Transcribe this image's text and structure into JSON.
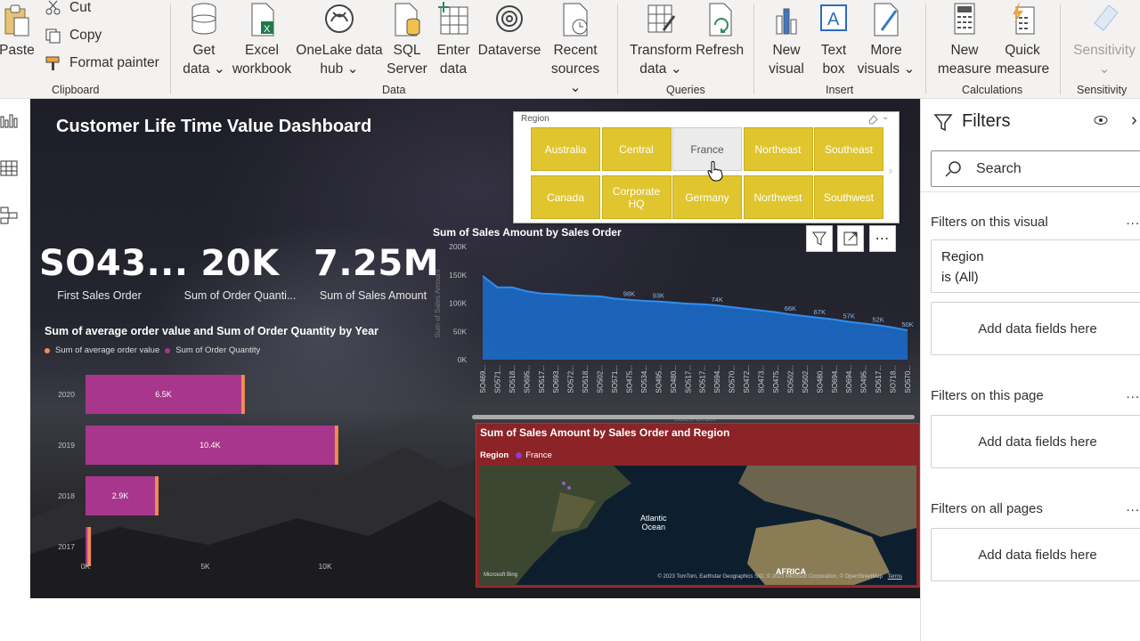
{
  "ribbon": {
    "clipboard": {
      "paste": "Paste",
      "cut": "Cut",
      "copy": "Copy",
      "format_painter": "Format painter",
      "group": "Clipboard"
    },
    "data": {
      "get_data": "Get\ndata ⌄",
      "excel": "Excel\nworkbook",
      "onelake": "OneLake data\nhub ⌄",
      "sql": "SQL\nServer",
      "enter": "Enter\ndata",
      "dataverse": "Dataverse",
      "recent": "Recent\nsources ⌄",
      "group": "Data"
    },
    "queries": {
      "transform": "Transform\ndata ⌄",
      "refresh": "Refresh",
      "group": "Queries"
    },
    "insert": {
      "new_visual": "New\nvisual",
      "text_box": "Text\nbox",
      "more_visuals": "More\nvisuals ⌄",
      "group": "Insert"
    },
    "calculations": {
      "new_measure": "New\nmeasure",
      "quick_measure": "Quick\nmeasure",
      "group": "Calculations"
    },
    "sensitivity": {
      "label": "Sensitivity\n⌄",
      "group": "Sensitivity"
    }
  },
  "dashboard": {
    "title": "Customer Life Time Value Dashboard",
    "kpis": [
      {
        "value": "SO43...",
        "label": "First Sales Order"
      },
      {
        "value": "20K",
        "label": "Sum of Order Quanti..."
      },
      {
        "value": "7.25M",
        "label": "Sum of Sales Amount"
      }
    ]
  },
  "slicer": {
    "title": "Region",
    "items": [
      "Australia",
      "Central",
      "France",
      "Northeast",
      "Southeast",
      "Canada",
      "Corporate\nHQ",
      "Germany",
      "Northwest",
      "Southwest"
    ],
    "selected": "France"
  },
  "bar_chart": {
    "title": "Sum of average order value and Sum of Order Quantity by Year",
    "legend": [
      "Sum of average order value",
      "Sum of Order Quantity"
    ]
  },
  "area_chart": {
    "title": "Sum of Sales Amount by Sales Order",
    "ylabel": "Sum of Sales Amount",
    "xlabel": "Sales Order",
    "x_ticks": [
      "SO469...",
      "SO571...",
      "SO518...",
      "SO695...",
      "SO517...",
      "SO693...",
      "SO572...",
      "SO518...",
      "SO502...",
      "SO571...",
      "SO475...",
      "SO534...",
      "SO495...",
      "SO480...",
      "SO517...",
      "SO517...",
      "SO694...",
      "SO570...",
      "SO472...",
      "SO473...",
      "SO475...",
      "SO502...",
      "SO502...",
      "SO480...",
      "SO694...",
      "SO694...",
      "SO495...",
      "SO517...",
      "SO718...",
      "SO570..."
    ],
    "point_labels": [
      "98K",
      "93K",
      "74K",
      "66K",
      "67K",
      "57K",
      "52K",
      "50K"
    ]
  },
  "map": {
    "title": "Sum of Sales Amount by Sales Order and Region",
    "legend_title": "Region",
    "legend_item": "France",
    "ocean_label": "Atlantic\nOcean",
    "africa_label": "AFRICA",
    "bing": "Microsoft Bing",
    "attribution": "© 2023 TomTom, Earthstar Geographics SIO, © 2023 Microsoft Corporation, © OpenStreetMap",
    "terms": "Terms"
  },
  "filters": {
    "title": "Filters",
    "search_placeholder": "Search",
    "on_visual": "Filters on this visual",
    "region_field": "Region",
    "region_value": "is (All)",
    "add_fields": "Add data fields here",
    "on_page": "Filters on this page",
    "on_all": "Filters on all pages",
    "dots": "..."
  },
  "colors": {
    "accent_purple": "#a7368c",
    "accent_orange": "#f28a57",
    "area_blue": "#1a6fd1",
    "slicer_yellow": "#e0c52e",
    "map_header": "#8c2427"
  },
  "chart_data": [
    {
      "type": "bar",
      "title": "Sum of average order value and Sum of Order Quantity by Year",
      "categories": [
        "2020",
        "2019",
        "2018",
        "2017"
      ],
      "series": [
        {
          "name": "Sum of Order Quantity",
          "values": [
            6500,
            10400,
            2900,
            80
          ]
        },
        {
          "name": "Sum of average order value",
          "values": [
            120,
            130,
            120,
            110
          ]
        }
      ],
      "data_labels": [
        "6.5K",
        "10.4K",
        "2.9K",
        ""
      ],
      "x_ticks": [
        "0K",
        "5K",
        "10K"
      ],
      "xlim": [
        0,
        11000
      ]
    },
    {
      "type": "area",
      "title": "Sum of Sales Amount by Sales Order",
      "ylabel": "Sum of Sales Amount",
      "xlabel": "Sales Order",
      "y_ticks": [
        "0K",
        "50K",
        "100K",
        "150K",
        "200K"
      ],
      "ylim": [
        0,
        200000
      ],
      "values": [
        148000,
        128000,
        128000,
        121000,
        117000,
        116000,
        114000,
        113000,
        112000,
        108000,
        106000,
        104000,
        103000,
        101000,
        99000,
        98000,
        96000,
        93000,
        90000,
        87000,
        84000,
        80000,
        77000,
        74000,
        71000,
        67000,
        64000,
        61000,
        57000,
        52000
      ]
    }
  ]
}
